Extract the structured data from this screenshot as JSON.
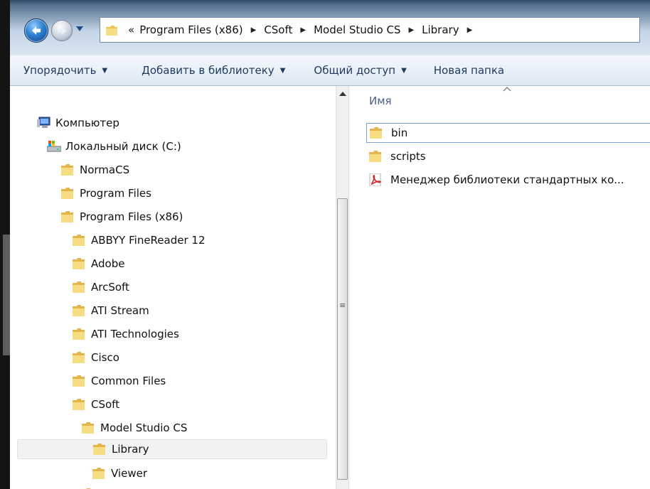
{
  "window": {
    "breadcrumb_overflow": "«",
    "breadcrumb": [
      "Program Files (x86)",
      "CSoft",
      "Model Studio CS",
      "Library"
    ]
  },
  "toolbar": {
    "organize": "Упорядочить",
    "add_to_library": "Добавить в библиотеку",
    "share": "Общий доступ",
    "new_folder": "Новая папка"
  },
  "nav_tree": {
    "computer": "Компьютер",
    "local_disk": "Локальный диск (C:)",
    "normacs": "NormaCS",
    "program_files": "Program Files",
    "program_files_x86": "Program Files (x86)",
    "abbyy": "ABBYY FineReader 12",
    "adobe": "Adobe",
    "arcsoft": "ArcSoft",
    "ati_stream": "ATI Stream",
    "ati_technologies": "ATI Technologies",
    "cisco": "Cisco",
    "common_files": "Common Files",
    "csoft": "CSoft",
    "model_studio": "Model Studio CS",
    "library": "Library",
    "viewer": "Viewer"
  },
  "content": {
    "column_name": "Имя",
    "items": [
      {
        "name": "bin",
        "icon": "folder-icon"
      },
      {
        "name": "scripts",
        "icon": "folder-icon"
      },
      {
        "name": "Менеджер библиотеки стандартных ко...",
        "icon": "pdf-icon"
      }
    ]
  },
  "colors": {
    "toolbar_text": "#1e395b",
    "column_header": "#4d6185",
    "folder": "#e9c45a"
  }
}
